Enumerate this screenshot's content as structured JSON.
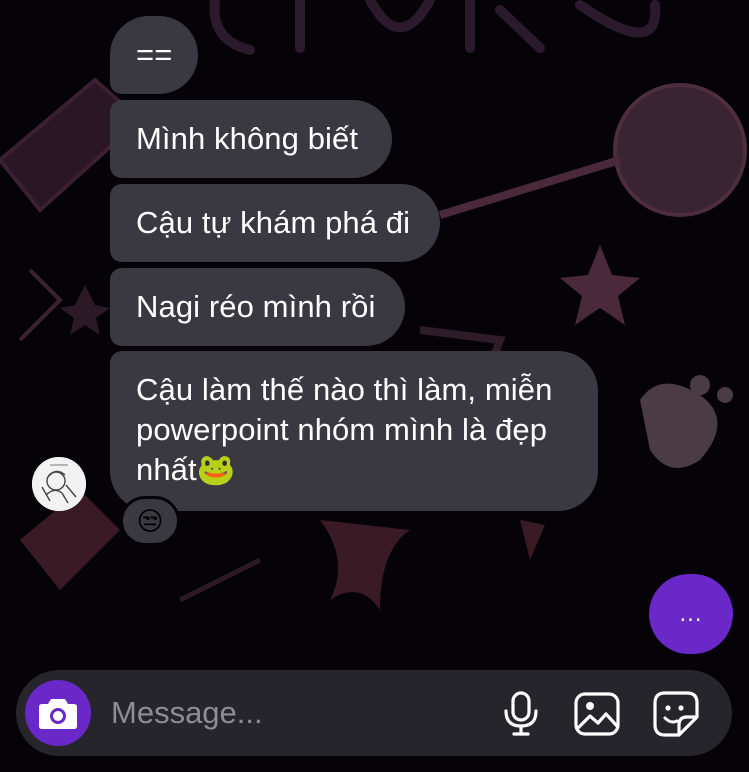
{
  "messages": [
    {
      "text": "=="
    },
    {
      "text": "Mình không biết"
    },
    {
      "text": "Cậu tự khám phá đi"
    },
    {
      "text": "Nagi réo mình rồi"
    },
    {
      "lines": [
        "Cậu làm thế nào thì làm, miễn",
        "powerpoint nhóm mình là đẹp",
        "nhất🐸"
      ]
    }
  ],
  "reaction": {
    "emoji": "😒"
  },
  "typing_indicator": {
    "label": "..."
  },
  "composer": {
    "placeholder": "Message...",
    "value": "",
    "icons": [
      "camera-icon",
      "microphone-icon",
      "gallery-icon",
      "sticker-icon"
    ]
  },
  "colors": {
    "accent": "#6a28c8",
    "bubble": "#3a3840",
    "composer": "#26252b",
    "background": "#050208"
  }
}
